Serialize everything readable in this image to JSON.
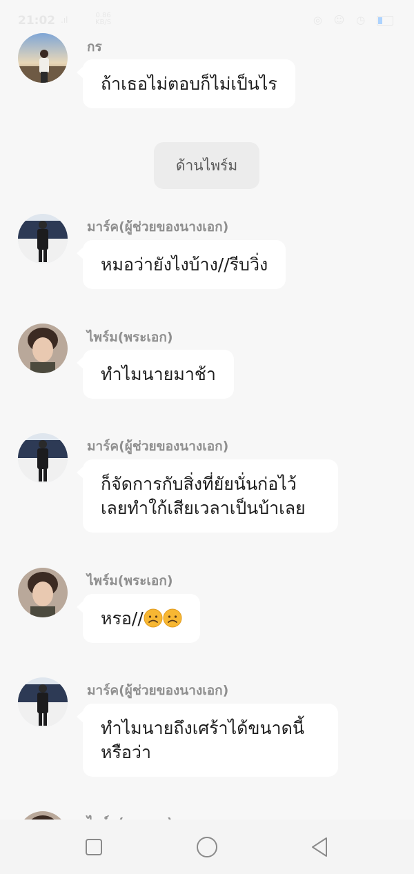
{
  "status_bar": {
    "time": "21:02",
    "signal": ".ıl",
    "speed_top": "0.86",
    "speed_bottom": "KB/S",
    "right_icons": "◎ ☺ ◷"
  },
  "system_message": "ด้านไพร์ม",
  "messages": [
    {
      "sender": "กร",
      "text": [
        "ถ้าเธอไม่ตอบก็ไม่เป็นไร"
      ]
    },
    {
      "sender": "มาร์ค(ผู้ช่วยของนางเอก)",
      "text": [
        "หมอว่ายังไงบ้าง//รีบวิ่ง"
      ]
    },
    {
      "sender": "ไพร์ม(พระเอก)",
      "text": [
        "ทำไมนายมาช้า"
      ]
    },
    {
      "sender": "มาร์ค(ผู้ช่วยของนางเอก)",
      "text": [
        "ก็จัดการกับสิ่งที่ยัยนั่นก่อไว้",
        "เลยทำใก้เสียเวลาเป็นบ้าเลย"
      ]
    },
    {
      "sender": "ไพร์ม(พระเอก)",
      "text": [
        "หรอ//"
      ],
      "emoji": [
        "worried-face-emoji",
        "worried-face-emoji"
      ]
    },
    {
      "sender": "มาร์ค(ผู้ช่วยของนางเอก)",
      "text": [
        "ทำไมนายถึงเศร้าได้ขนาดนี้",
        "หรือว่า"
      ]
    },
    {
      "sender": "ไพร์ม(พระเอก)",
      "text": []
    }
  ],
  "nav": {
    "recent_icon": "square-recent-apps-icon",
    "home_icon": "circle-home-icon",
    "back_icon": "triangle-back-icon"
  },
  "colors": {
    "background": "#f7f7f7",
    "bubble": "#ffffff",
    "sender": "#8f8f8f",
    "system_chip": "#ececec"
  }
}
